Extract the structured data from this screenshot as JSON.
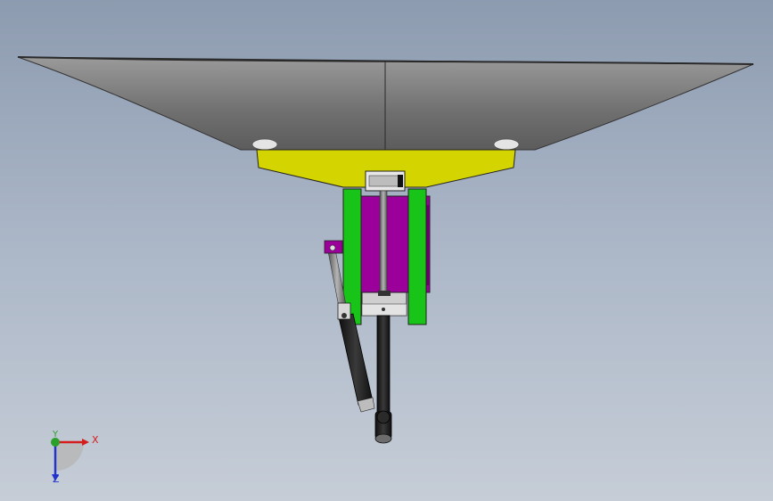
{
  "viewport": {
    "background_top": "#8d9bb0",
    "background_bottom": "#c6cdd7"
  },
  "model": {
    "parts": [
      {
        "name": "reflector-dish",
        "color": "#7a7a7a"
      },
      {
        "name": "mounting-plate",
        "color": "#d4d400"
      },
      {
        "name": "side-bracket",
        "color": "#17c417"
      },
      {
        "name": "center-block",
        "color": "#9b009b"
      },
      {
        "name": "actuator-rod",
        "color": "#1e1e1e"
      }
    ]
  },
  "triad": {
    "x_label": "X",
    "y_label": "Y",
    "z_label": "Z",
    "x_color": "#d41e1e",
    "y_color": "#2aa02a",
    "z_color": "#2233cc"
  }
}
